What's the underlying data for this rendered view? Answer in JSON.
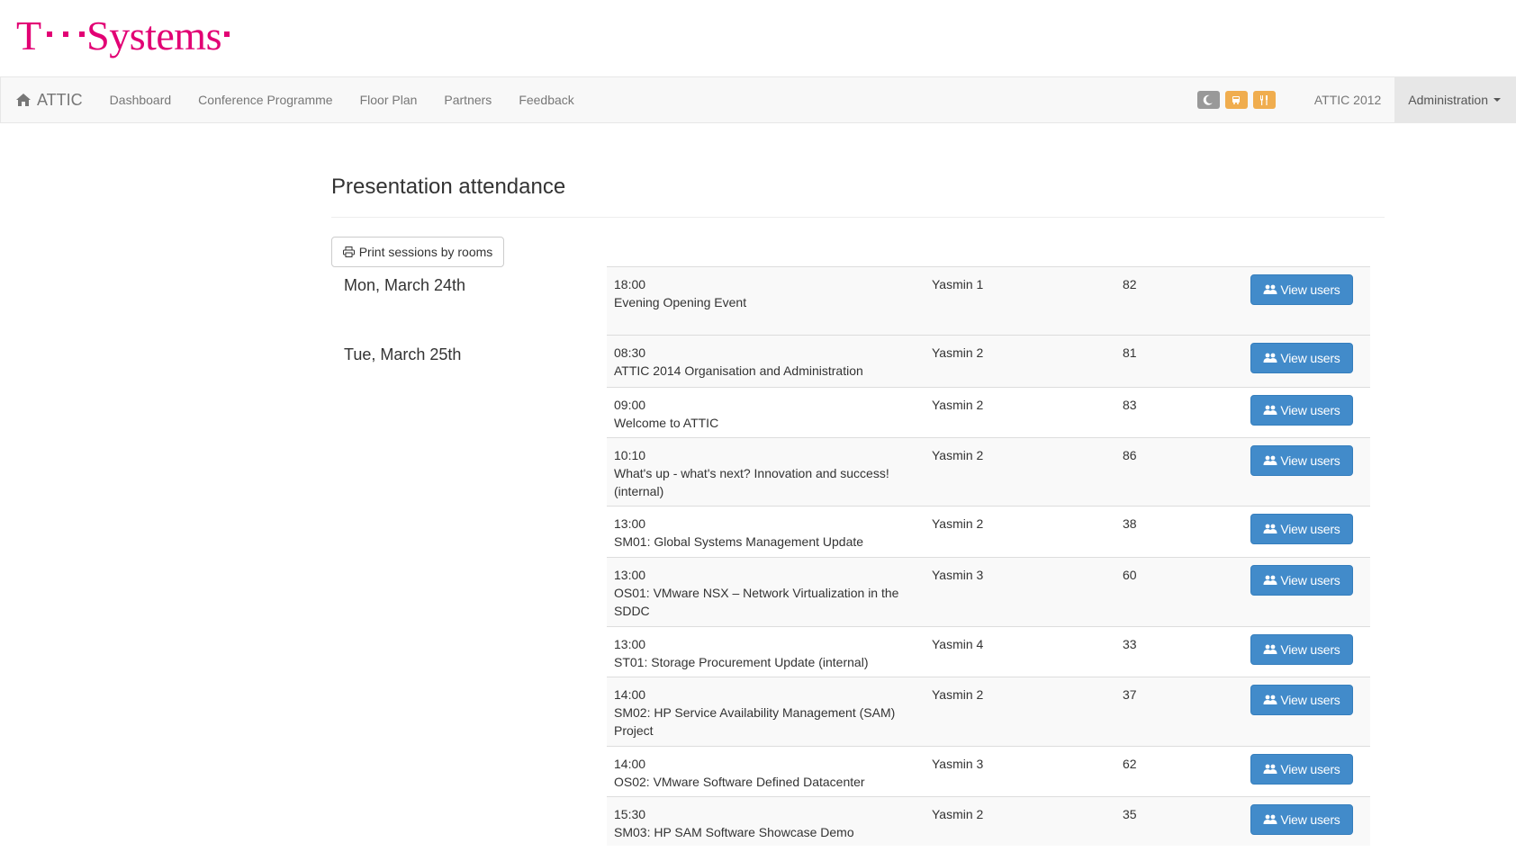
{
  "logo": {
    "t": "T",
    "word": "Systems"
  },
  "navbar": {
    "brand": "ATTIC",
    "items": [
      "Dashboard",
      "Conference Programme",
      "Floor Plan",
      "Partners",
      "Feedback"
    ],
    "status_icons": [
      {
        "name": "moon-icon",
        "color": "#999999"
      },
      {
        "name": "bus-icon",
        "color": "#f0ad4e"
      },
      {
        "name": "cutlery-icon",
        "color": "#f0ad4e"
      }
    ],
    "year": "ATTIC 2012",
    "admin": "Administration"
  },
  "page": {
    "title": "Presentation attendance",
    "print_button": "Print sessions by rooms"
  },
  "days": [
    {
      "label": "Mon, March 24th"
    },
    {
      "label": "Tue, March 25th"
    }
  ],
  "view_button_label": "View users",
  "sessions": [
    {
      "time": "18:00",
      "title": "Evening Opening Event",
      "room": "Yasmin 1",
      "count": "82"
    },
    {
      "time": "08:30",
      "title": "ATTIC 2014 Organisation and Administration",
      "room": "Yasmin 2",
      "count": "81"
    },
    {
      "time": "09:00",
      "title": "Welcome to ATTIC",
      "room": "Yasmin 2",
      "count": "83"
    },
    {
      "time": "10:10",
      "title": "What's up - what's next? Innovation and success! (internal)",
      "room": "Yasmin 2",
      "count": "86"
    },
    {
      "time": "13:00",
      "title": "SM01: Global Systems Management Update",
      "room": "Yasmin 2",
      "count": "38"
    },
    {
      "time": "13:00",
      "title": "OS01: VMware NSX – Network Virtualization in the SDDC",
      "room": "Yasmin 3",
      "count": "60"
    },
    {
      "time": "13:00",
      "title": "ST01: Storage Procurement Update (internal)",
      "room": "Yasmin 4",
      "count": "33"
    },
    {
      "time": "14:00",
      "title": "SM02: HP Service Availability Management (SAM) Project",
      "room": "Yasmin 2",
      "count": "37"
    },
    {
      "time": "14:00",
      "title": "OS02: VMware Software Defined Datacenter",
      "room": "Yasmin 3",
      "count": "62"
    },
    {
      "time": "15:30",
      "title": "SM03: HP SAM Software Showcase Demo",
      "room": "Yasmin 2",
      "count": "35"
    }
  ]
}
